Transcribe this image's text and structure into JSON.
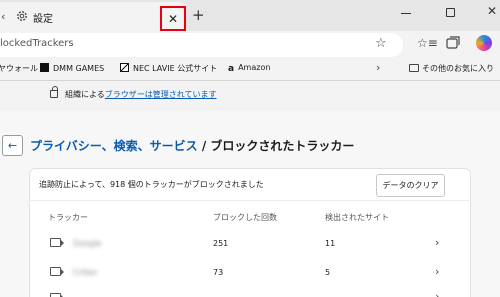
{
  "tab": {
    "title": "設定"
  },
  "address": {
    "text": "lockedTrackers"
  },
  "bookmarks": [
    {
      "label": "ヤウォール"
    },
    {
      "label": "DMM GAMES"
    },
    {
      "label": "NEC LAVIE 公式サイト"
    },
    {
      "label": "Amazon"
    }
  ],
  "bookmarks_other": "その他のお気に入り",
  "banner": {
    "prefix": "組織による",
    "link": "ブラウザーは管理されています"
  },
  "heading": {
    "link": "プライバシー、検索、サービス",
    "separator": " / ",
    "current": "ブロックされたトラッカー"
  },
  "summary": "追跡防止によって、918 個のトラッカーがブロックされました",
  "clear_button": "データのクリア",
  "columns": {
    "tracker": "トラッカー",
    "blocked": "ブロックした回数",
    "sites": "検出されたサイト"
  },
  "rows": [
    {
      "name": "Google",
      "blocked": "251",
      "sites": "11"
    },
    {
      "name": "Criteo",
      "blocked": "73",
      "sites": "5"
    }
  ],
  "colors": {
    "accent": "#0b5cad",
    "highlight_box": "#e60012"
  }
}
